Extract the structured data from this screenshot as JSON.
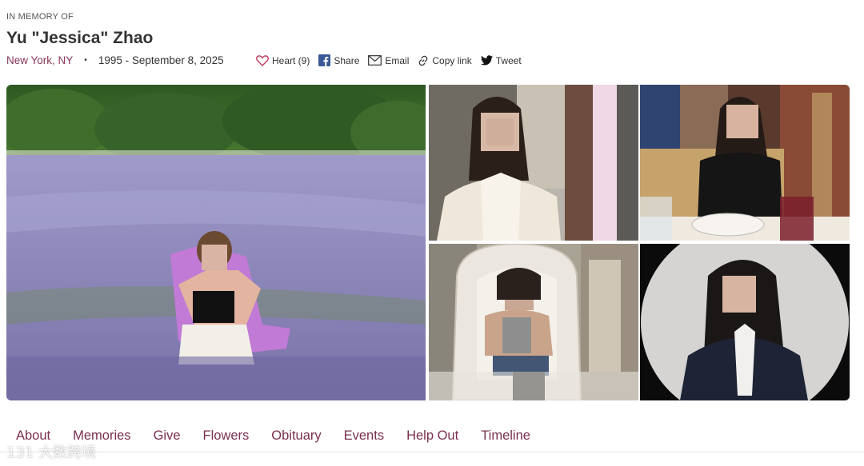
{
  "header": {
    "kicker": "IN MEMORY OF",
    "name": "Yu \"Jessica\" Zhao",
    "location": "New York, NY",
    "separator": "•",
    "dates": "1995 - September 8, 2025"
  },
  "actions": [
    {
      "label": "Heart (9)",
      "icon": "heart-icon"
    },
    {
      "label": "Share",
      "icon": "facebook-icon"
    },
    {
      "label": "Email",
      "icon": "mail-icon"
    },
    {
      "label": "Copy link",
      "icon": "link-icon"
    },
    {
      "label": "Tweet",
      "icon": "twitter-icon"
    }
  ],
  "tabs": [
    "About",
    "Memories",
    "Give",
    "Flowers",
    "Obituary",
    "Events",
    "Help Out",
    "Timeline"
  ],
  "watermark": "131 大数跨境",
  "colors": {
    "accent": "#8a3558",
    "tab": "#7a2f4f",
    "facebook": "#3b5998",
    "heart": "#c0395a"
  }
}
